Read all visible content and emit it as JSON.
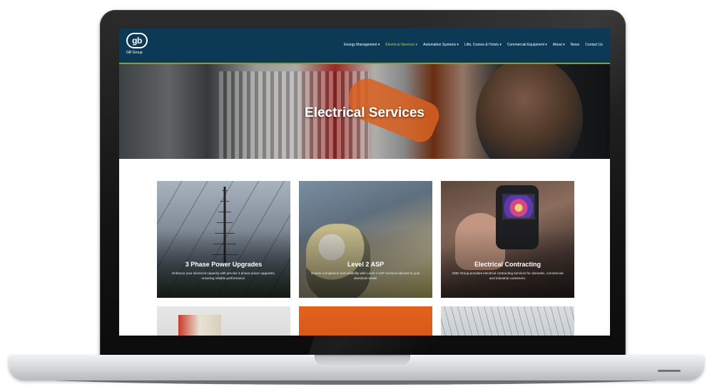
{
  "site": {
    "logo_text": "GB Group",
    "logo_mark": "gb"
  },
  "nav": {
    "items": [
      "Energy Management ▾",
      "Electrical Services ▾",
      "Automation Systems ▾",
      "Lifts, Cranes & Hoists ▾",
      "Commercial Equipment ▾",
      "About ▾",
      "News",
      "Contact Us"
    ]
  },
  "hero": {
    "title": "Electrical Services"
  },
  "cards": [
    {
      "title": "3 Phase Power Upgrades",
      "description": "Enhance your electrical capacity with precise 3 phase power upgrades, ensuring reliable performance."
    },
    {
      "title": "Level 2 ASP",
      "description": "Ensure compliance and reliability with Level 2 ASP services tailored to your electrical needs."
    },
    {
      "title": "Electrical Contracting",
      "description": "GBE Group provides electrical contracting services for domestic, commercial and industrial customers."
    }
  ],
  "colors": {
    "nav_bg": "#0c3a56",
    "nav_accent": "#b8d245"
  }
}
